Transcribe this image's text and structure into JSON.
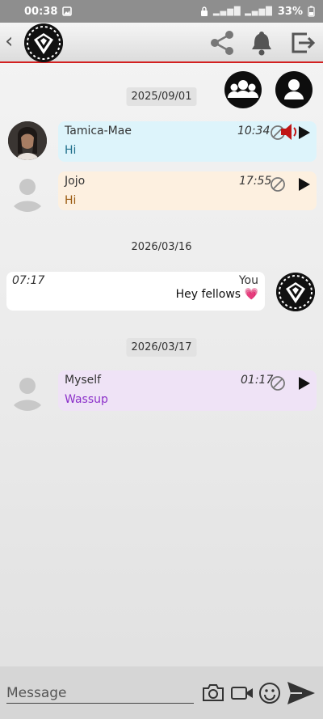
{
  "status_bar": {
    "time": "00:38",
    "battery": "33%"
  },
  "app_bar": {
    "back_icon": "chevron-left-icon",
    "logo": "group-logo"
  },
  "actions": {
    "share": "share-icon",
    "bell": "bell-icon",
    "exit": "exit-icon",
    "members": "group-icon",
    "profile": "person-icon"
  },
  "messages": [
    {
      "date": "2025/09/01",
      "sender": "Tamica-Mae",
      "time": "10:34",
      "text": "Hi",
      "bubble_color": "#ddf4fb",
      "text_color": "#1f6f8b"
    },
    {
      "sender": "Jojo",
      "time": "17:55",
      "text": "Hi",
      "bubble_color": "#fdf0e0",
      "text_color": "#9a5a10"
    },
    {
      "date": "2026/03/16",
      "sender": "You",
      "time": "07:17",
      "text": "Hey fellows",
      "emoji": "💗",
      "bubble_color": "#ffffff",
      "text_color": "#111111"
    },
    {
      "date": "2026/03/17",
      "sender": "Myself",
      "time": "01:17",
      "text": "Wassup",
      "bubble_color": "#efe3f6",
      "text_color": "#8b2fc9"
    }
  ],
  "composer": {
    "placeholder": "Message"
  },
  "colors": {
    "accent_red": "#d32020",
    "play": "#111111"
  }
}
